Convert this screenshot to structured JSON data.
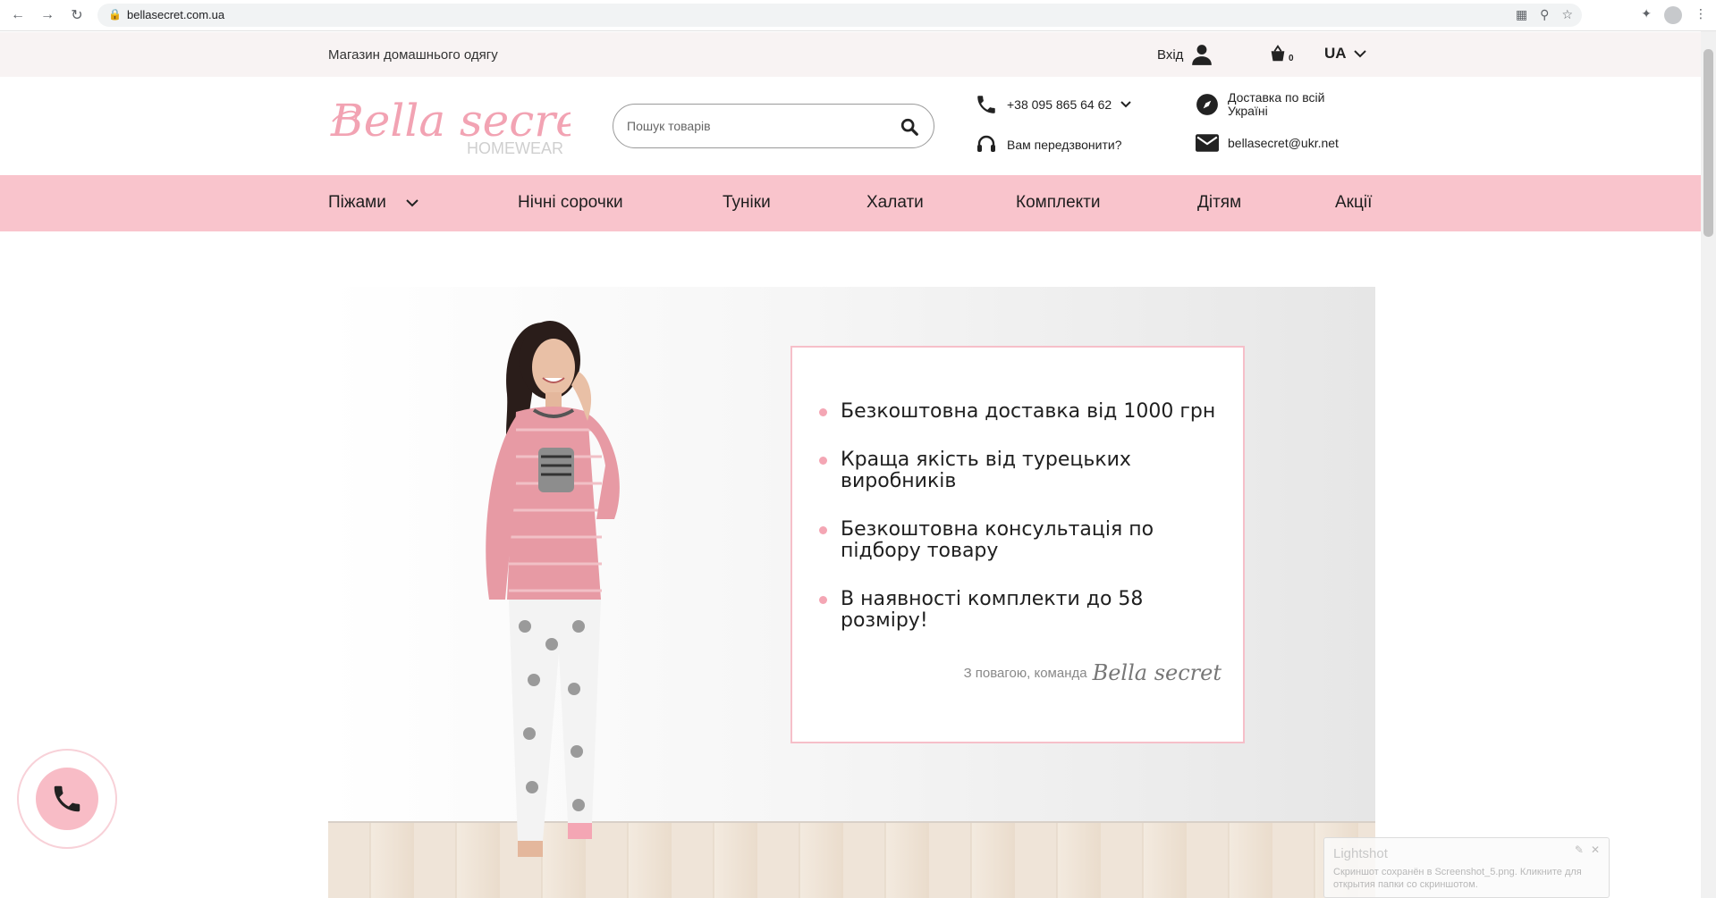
{
  "browser": {
    "url": "bellasecret.com.ua",
    "icons": [
      "back-icon",
      "forward-icon",
      "reload-icon",
      "lock-icon",
      "translate-icon",
      "zoom-icon",
      "star-icon",
      "extensions-icon",
      "profile-icon",
      "menu-icon"
    ]
  },
  "topbar": {
    "tagline": "Магазин домашнього одягу",
    "login_label": "Вхід",
    "cart_count": "0",
    "language": "UA"
  },
  "header": {
    "logo_text": "Bella secret",
    "logo_sub": "HOMEWEAR",
    "search_placeholder": "Пошук товарів",
    "phone": "+38 095 865 64 62",
    "callback": "Вам передзвонити?",
    "delivery_line1": "Доставка по всій",
    "delivery_line2": "Україні",
    "email": "bellasecret@ukr.net"
  },
  "nav": {
    "items": [
      {
        "label": "Піжами"
      },
      {
        "label": "Нічні сорочки"
      },
      {
        "label": "Туніки"
      },
      {
        "label": "Халати"
      },
      {
        "label": "Комплекти"
      },
      {
        "label": "Дітям"
      },
      {
        "label": "Акції"
      }
    ]
  },
  "promo": {
    "items": [
      {
        "line1": "Безкоштовна доставка від 1000 грн",
        "line2": ""
      },
      {
        "line1": "Краща якість від турецьких",
        "line2": "виробників"
      },
      {
        "line1": "Безкоштовна консультація по",
        "line2": "підбору товару"
      },
      {
        "line1": "В наявності комплекти до 58 розміру!",
        "line2": ""
      }
    ],
    "signature_prefix": "З повагою, команда",
    "signature_brand": "Bella secret"
  },
  "colors": {
    "nav_bg": "#f9c4cc",
    "topbar_bg": "#f8f3f3",
    "accent_pink": "#f4a6b4",
    "logo_pink": "#f2a3b3"
  },
  "toast": {
    "title": "Lightshot",
    "message": "Скриншот сохранён в Screenshot_5.png. Кликните для открытия папки со скриншотом."
  }
}
